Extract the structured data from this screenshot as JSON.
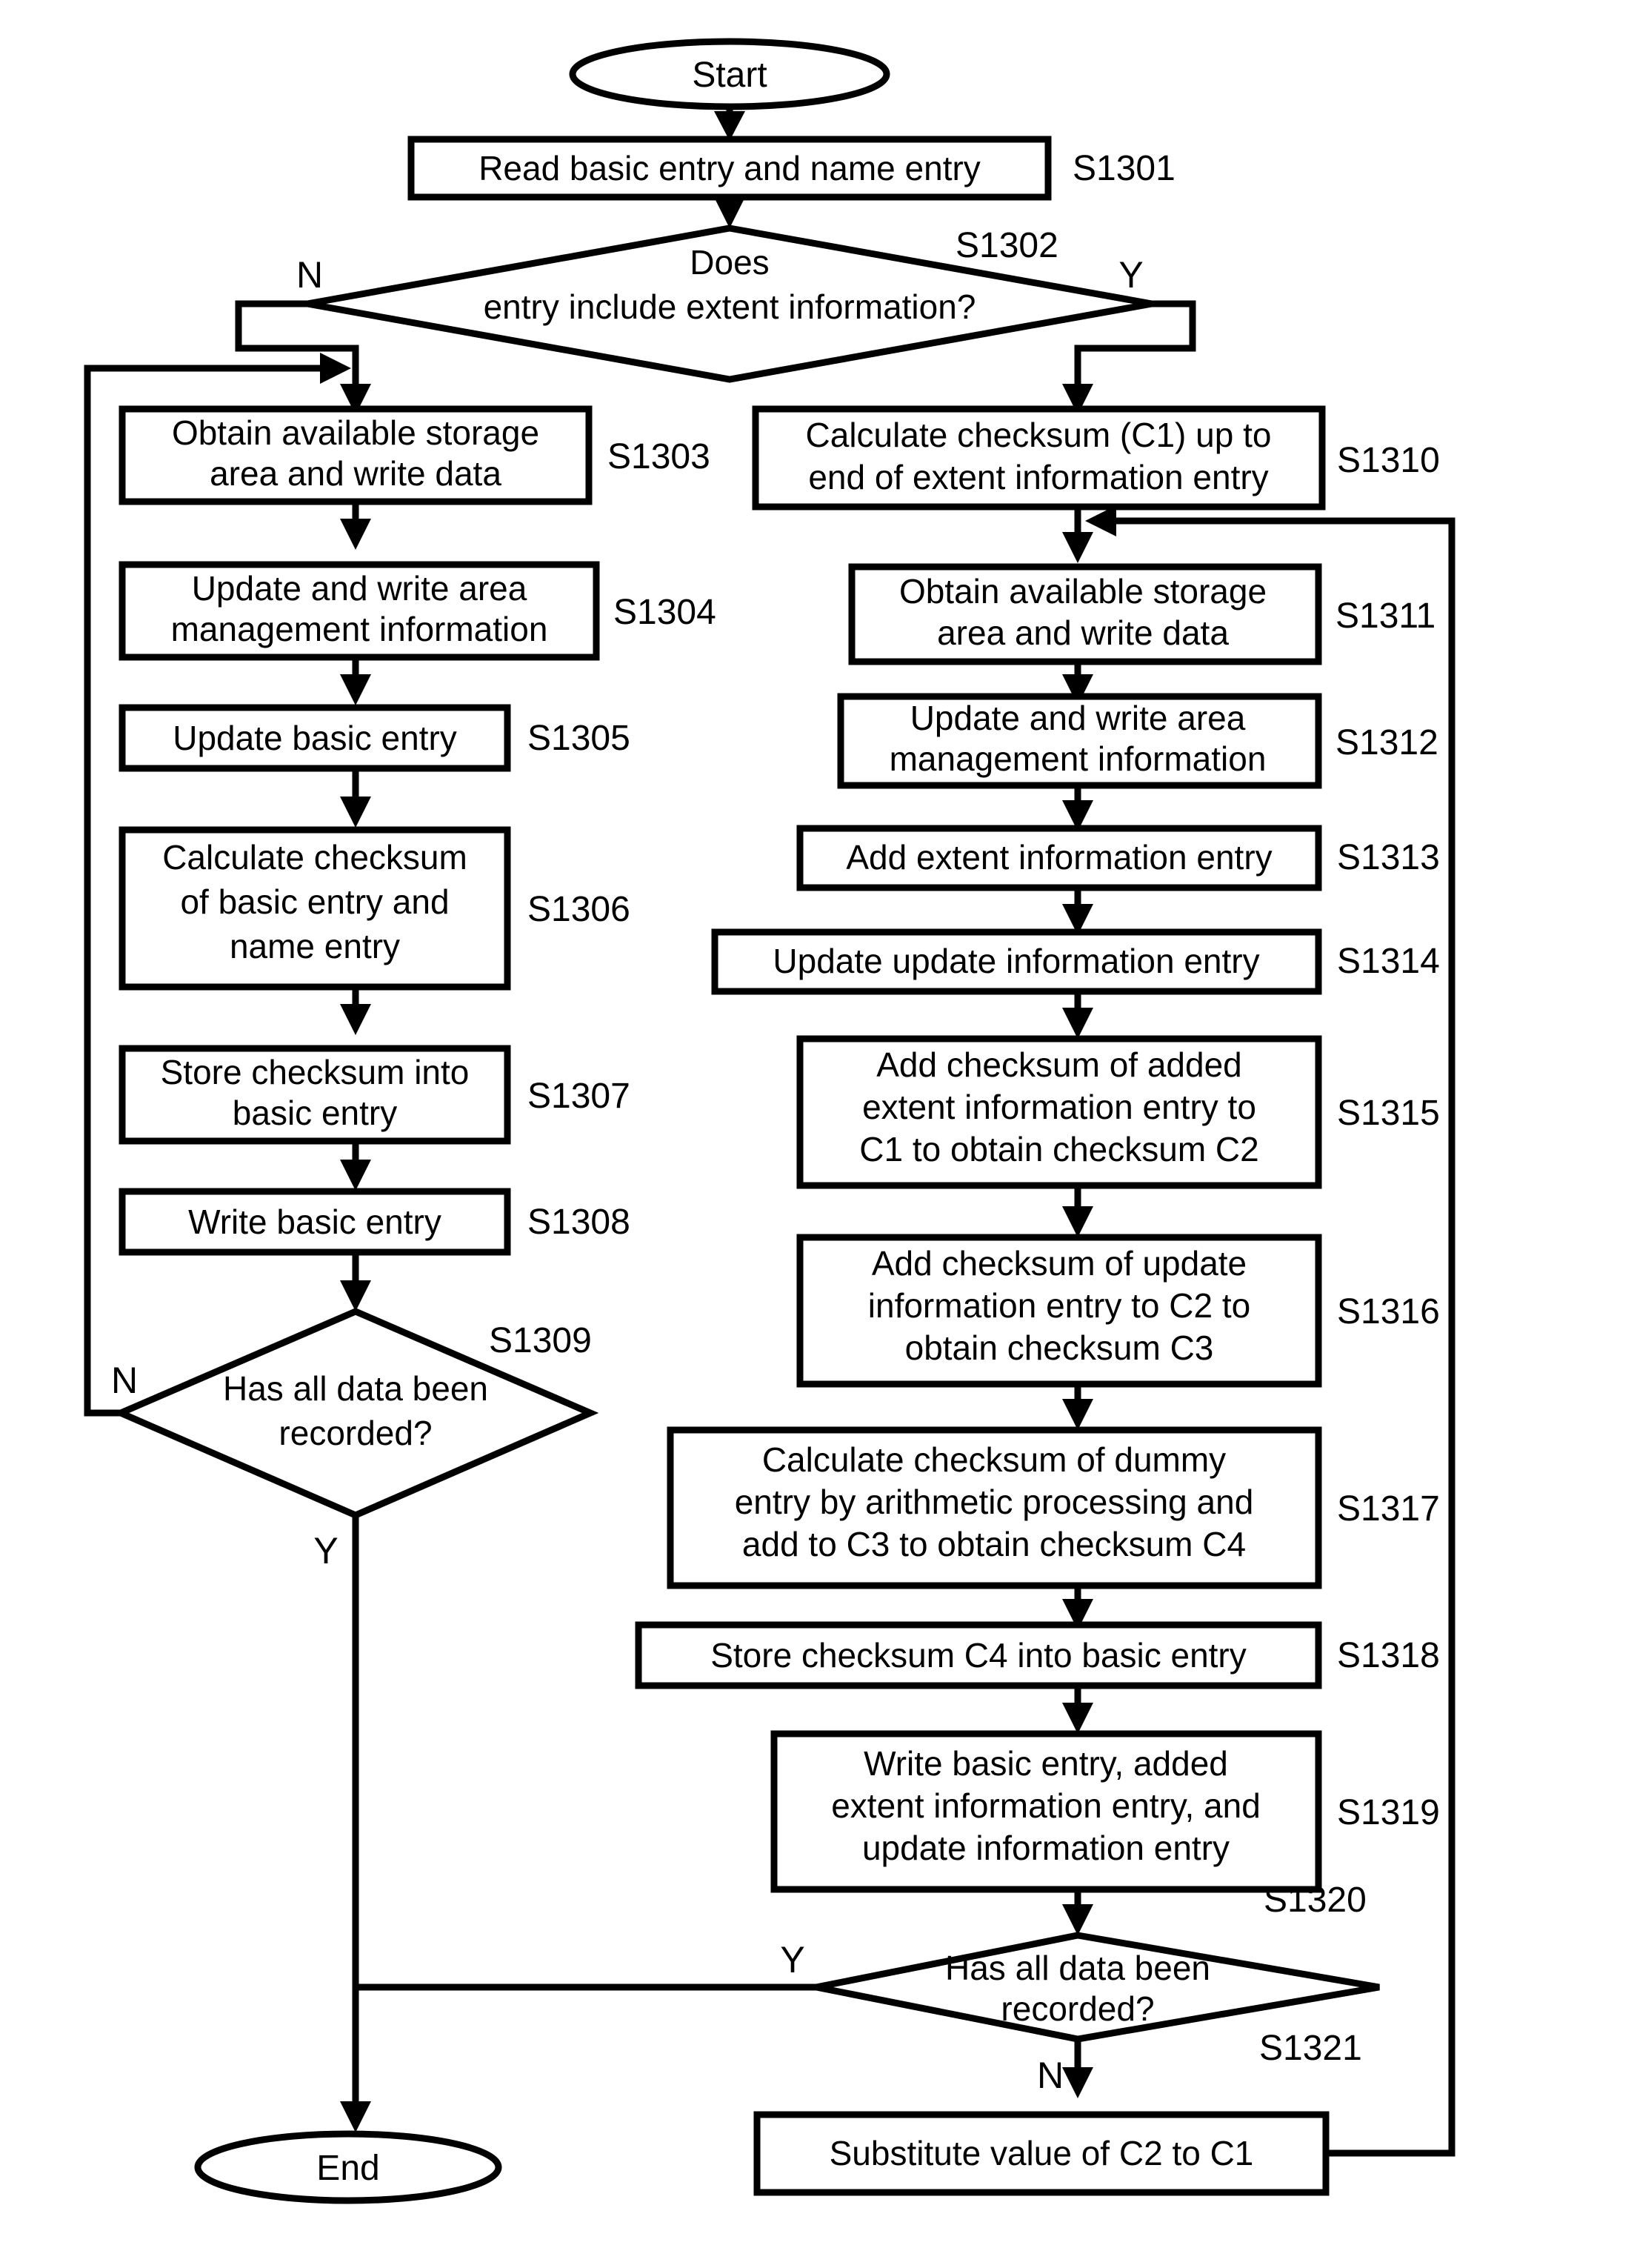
{
  "figure": {
    "type": "flowchart",
    "terminals": {
      "start": "Start",
      "end": "End"
    },
    "nodes": [
      {
        "id": "S1301",
        "kind": "process",
        "step": "S1301",
        "lines": [
          "Read basic entry and name entry"
        ]
      },
      {
        "id": "S1302",
        "kind": "decision",
        "step": "S1302",
        "lines": [
          "Does",
          "entry include extent information?"
        ],
        "branch_no": "N",
        "branch_yes": "Y"
      },
      {
        "id": "S1303",
        "kind": "process",
        "step": "S1303",
        "lines": [
          "Obtain available storage",
          "area and write data"
        ]
      },
      {
        "id": "S1304",
        "kind": "process",
        "step": "S1304",
        "lines": [
          "Update and write area",
          "management information"
        ]
      },
      {
        "id": "S1305",
        "kind": "process",
        "step": "S1305",
        "lines": [
          "Update basic entry"
        ]
      },
      {
        "id": "S1306",
        "kind": "process",
        "step": "S1306",
        "lines": [
          "Calculate checksum",
          "of basic entry and",
          "name entry"
        ]
      },
      {
        "id": "S1307",
        "kind": "process",
        "step": "S1307",
        "lines": [
          "Store checksum into",
          "basic entry"
        ]
      },
      {
        "id": "S1308",
        "kind": "process",
        "step": "S1308",
        "lines": [
          "Write basic entry"
        ]
      },
      {
        "id": "S1309",
        "kind": "decision",
        "step": "S1309",
        "lines": [
          "Has all data been",
          "recorded?"
        ],
        "branch_no": "N",
        "branch_yes": "Y"
      },
      {
        "id": "S1310",
        "kind": "process",
        "step": "S1310",
        "lines": [
          "Calculate checksum (C1) up to",
          "end of extent information entry"
        ]
      },
      {
        "id": "S1311",
        "kind": "process",
        "step": "S1311",
        "lines": [
          "Obtain available storage",
          "area and write data"
        ]
      },
      {
        "id": "S1312",
        "kind": "process",
        "step": "S1312",
        "lines": [
          "Update and write area",
          "management information"
        ]
      },
      {
        "id": "S1313",
        "kind": "process",
        "step": "S1313",
        "lines": [
          "Add extent information entry"
        ]
      },
      {
        "id": "S1314",
        "kind": "process",
        "step": "S1314",
        "lines": [
          "Update update information entry"
        ]
      },
      {
        "id": "S1315",
        "kind": "process",
        "step": "S1315",
        "lines": [
          "Add checksum of added",
          "extent information entry to",
          "C1 to obtain checksum C2"
        ]
      },
      {
        "id": "S1316",
        "kind": "process",
        "step": "S1316",
        "lines": [
          "Add checksum of update",
          "information entry to C2 to",
          "obtain checksum C3"
        ]
      },
      {
        "id": "S1317",
        "kind": "process",
        "step": "S1317",
        "lines": [
          "Calculate checksum of dummy",
          "entry by arithmetic processing and",
          "add to C3 to obtain checksum C4"
        ]
      },
      {
        "id": "S1318",
        "kind": "process",
        "step": "S1318",
        "lines": [
          "Store checksum C4 into basic entry"
        ]
      },
      {
        "id": "S1319",
        "kind": "process",
        "step": "S1319",
        "lines": [
          "Write basic entry, added",
          "extent information entry, and",
          "update information entry"
        ]
      },
      {
        "id": "S1320",
        "kind": "decision",
        "step": "S1320",
        "lines": [
          "Has all data been",
          "recorded?"
        ],
        "branch_no": "N",
        "branch_yes": "Y"
      },
      {
        "id": "S1321",
        "kind": "process",
        "step": "S1321",
        "lines": [
          "Substitute value of C2 to C1"
        ]
      }
    ],
    "labels": {
      "s1302_n": "N",
      "s1302_y": "Y",
      "s1309_n": "N",
      "s1309_y": "Y",
      "s1320_y": "Y",
      "s1320_n": "N"
    },
    "colors": {
      "stroke": "#000000",
      "fill": "#ffffff",
      "text": "#000000"
    }
  }
}
